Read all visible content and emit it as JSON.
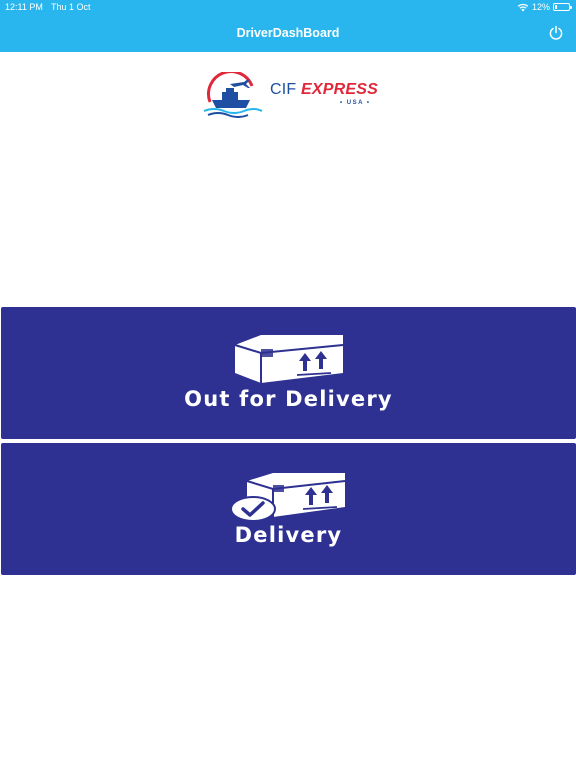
{
  "status_bar": {
    "time": "12:11 PM",
    "date": "Thu 1 Oct",
    "battery": "12%",
    "battery_level": 0.12,
    "wifi_icon": "wifi-icon"
  },
  "nav": {
    "title": "DriverDashBoard",
    "power_icon": "power-icon"
  },
  "logo": {
    "name": "CIF",
    "name2": "EXPRESS",
    "sub": "USA",
    "colors": {
      "blue": "#1e4fa3",
      "red": "#e0283a"
    }
  },
  "actions": {
    "out_for_delivery": {
      "label": "Out for Delivery",
      "icon": "package-upload-icon"
    },
    "delivery": {
      "label": "Delivery",
      "icon": "package-delivered-icon"
    }
  },
  "colors": {
    "topbar": "#29b6ee",
    "tile": "#2e3192",
    "background": "#ffffff"
  }
}
